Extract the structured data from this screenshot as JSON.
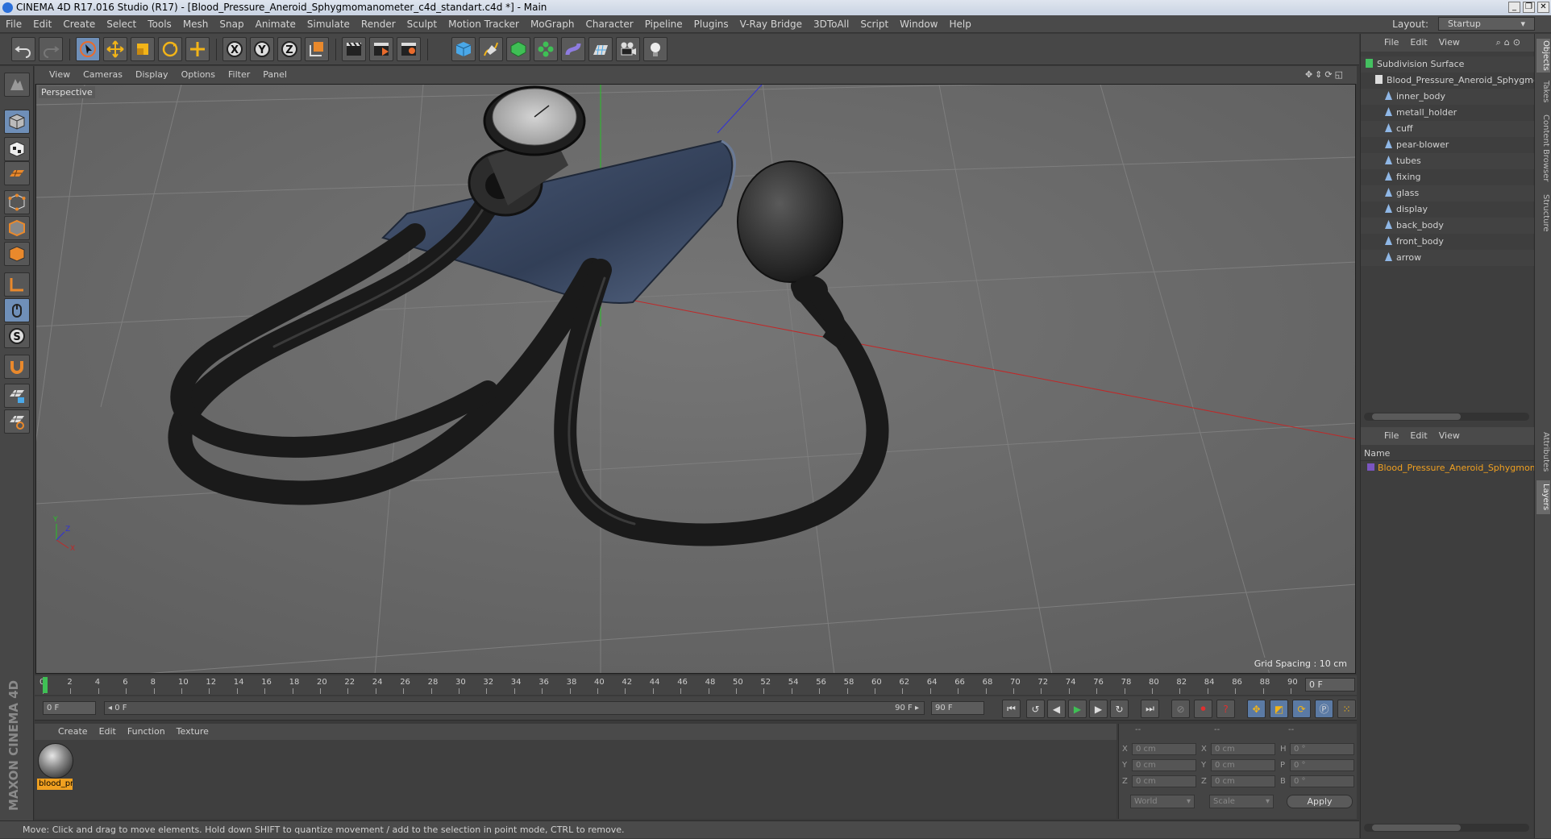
{
  "window": {
    "title": "CINEMA 4D R17.016 Studio (R17) - [Blood_Pressure_Aneroid_Sphygmomanometer_c4d_standart.c4d *] - Main",
    "minimize": "_",
    "restore": "❐",
    "close": "✕"
  },
  "menubar": {
    "items": [
      "File",
      "Edit",
      "Create",
      "Select",
      "Tools",
      "Mesh",
      "Snap",
      "Animate",
      "Simulate",
      "Render",
      "Sculpt",
      "Motion Tracker",
      "MoGraph",
      "Character",
      "Pipeline",
      "Plugins",
      "V-Ray Bridge",
      "3DToAll",
      "Script",
      "Window",
      "Help"
    ],
    "layout_label": "Layout:",
    "layout_value": "Startup"
  },
  "viewport": {
    "menu": [
      "View",
      "Cameras",
      "Display",
      "Options",
      "Filter",
      "Panel"
    ],
    "camera_label": "Perspective",
    "grid_spacing": "Grid Spacing : 10 cm",
    "axis_labels": {
      "y": "Y",
      "z": "Z",
      "x": "X"
    }
  },
  "timeline": {
    "ticks": [
      "0",
      "2",
      "4",
      "6",
      "8",
      "10",
      "12",
      "14",
      "16",
      "18",
      "20",
      "22",
      "24",
      "26",
      "28",
      "30",
      "32",
      "34",
      "36",
      "38",
      "40",
      "42",
      "44",
      "46",
      "48",
      "50",
      "52",
      "54",
      "56",
      "58",
      "60",
      "62",
      "64",
      "66",
      "68",
      "70",
      "72",
      "74",
      "76",
      "78",
      "80",
      "82",
      "84",
      "86",
      "88",
      "90"
    ],
    "current_frame": "0 F",
    "start_field": "0 F",
    "range_start": "0 F",
    "range_end": "90 F",
    "end_field": "90 F"
  },
  "materials": {
    "menu": [
      "Create",
      "Edit",
      "Function",
      "Texture"
    ],
    "items": [
      {
        "label": "blood_pr"
      }
    ]
  },
  "coordinates": {
    "headers": [
      "--",
      "--",
      "--"
    ],
    "rows": [
      {
        "a": "X",
        "av": "0 cm",
        "b": "X",
        "bv": "0 cm",
        "c": "H",
        "cv": "0 °"
      },
      {
        "a": "Y",
        "av": "0 cm",
        "b": "Y",
        "bv": "0 cm",
        "c": "P",
        "cv": "0 °"
      },
      {
        "a": "Z",
        "av": "0 cm",
        "b": "Z",
        "bv": "0 cm",
        "c": "B",
        "cv": "0 °"
      }
    ],
    "mode_select": "World",
    "scale_select": "Scale",
    "apply": "Apply"
  },
  "status": "Move: Click and drag to move elements. Hold down SHIFT to quantize movement / add to the selection in point mode, CTRL to remove.",
  "object_manager": {
    "menu": [
      "File",
      "Edit",
      "View"
    ],
    "objects": [
      {
        "label": "Subdivision Surface",
        "indent": 0,
        "icon_color": "#44c060"
      },
      {
        "label": "Blood_Pressure_Aneroid_Sphygmo",
        "indent": 1,
        "icon_color": "#dddddd"
      },
      {
        "label": "inner_body",
        "indent": 2,
        "icon_color": "#8fb7e6"
      },
      {
        "label": "metall_holder",
        "indent": 2,
        "icon_color": "#8fb7e6"
      },
      {
        "label": "cuff",
        "indent": 2,
        "icon_color": "#8fb7e6"
      },
      {
        "label": "pear-blower",
        "indent": 2,
        "icon_color": "#8fb7e6"
      },
      {
        "label": "tubes",
        "indent": 2,
        "icon_color": "#8fb7e6"
      },
      {
        "label": "fixing",
        "indent": 2,
        "icon_color": "#8fb7e6"
      },
      {
        "label": "glass",
        "indent": 2,
        "icon_color": "#8fb7e6"
      },
      {
        "label": "display",
        "indent": 2,
        "icon_color": "#8fb7e6"
      },
      {
        "label": "back_body",
        "indent": 2,
        "icon_color": "#8fb7e6"
      },
      {
        "label": "front_body",
        "indent": 2,
        "icon_color": "#8fb7e6"
      },
      {
        "label": "arrow",
        "indent": 2,
        "icon_color": "#8fb7e6"
      }
    ]
  },
  "layer_manager": {
    "menu": [
      "File",
      "Edit",
      "View"
    ],
    "name_header": "Name",
    "item": "Blood_Pressure_Aneroid_Sphygmom"
  },
  "side_tabs": [
    "Objects",
    "Takes",
    "Content Browser",
    "Structure",
    "Attributes",
    "Layers"
  ],
  "logo": "MAXON CINEMA 4D",
  "colors": {
    "accent": "#f0a020",
    "selected_tool": "#6f8fb8"
  }
}
